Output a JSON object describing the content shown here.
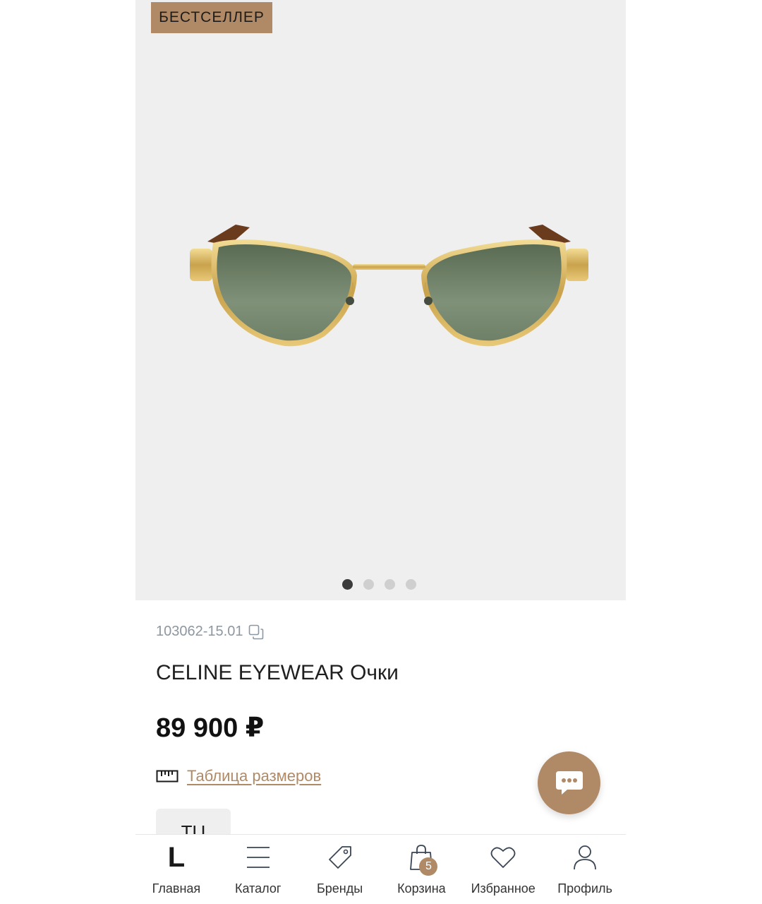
{
  "badge": "БЕСТСЕЛЛЕР",
  "product": {
    "sku": "103062-15.01",
    "title": "CELINE EYEWEAR Очки",
    "price": "89 900 ₽",
    "size_table_label": "Таблица размеров",
    "size_option": "TU"
  },
  "gallery": {
    "slide_count": 4,
    "active_index": 0
  },
  "nav": {
    "logo": "L",
    "items": [
      {
        "label": "Главная",
        "icon": "logo-l-icon"
      },
      {
        "label": "Каталог",
        "icon": "menu-icon"
      },
      {
        "label": "Бренды",
        "icon": "tag-icon"
      },
      {
        "label": "Корзина",
        "icon": "bag-icon"
      },
      {
        "label": "Избранное",
        "icon": "heart-icon"
      },
      {
        "label": "Профиль",
        "icon": "user-icon"
      }
    ],
    "cart_count": "5"
  },
  "colors": {
    "accent": "#b08a66",
    "image_bg": "#efefef",
    "text": "#1f1f1f",
    "muted": "#8d97a1"
  }
}
